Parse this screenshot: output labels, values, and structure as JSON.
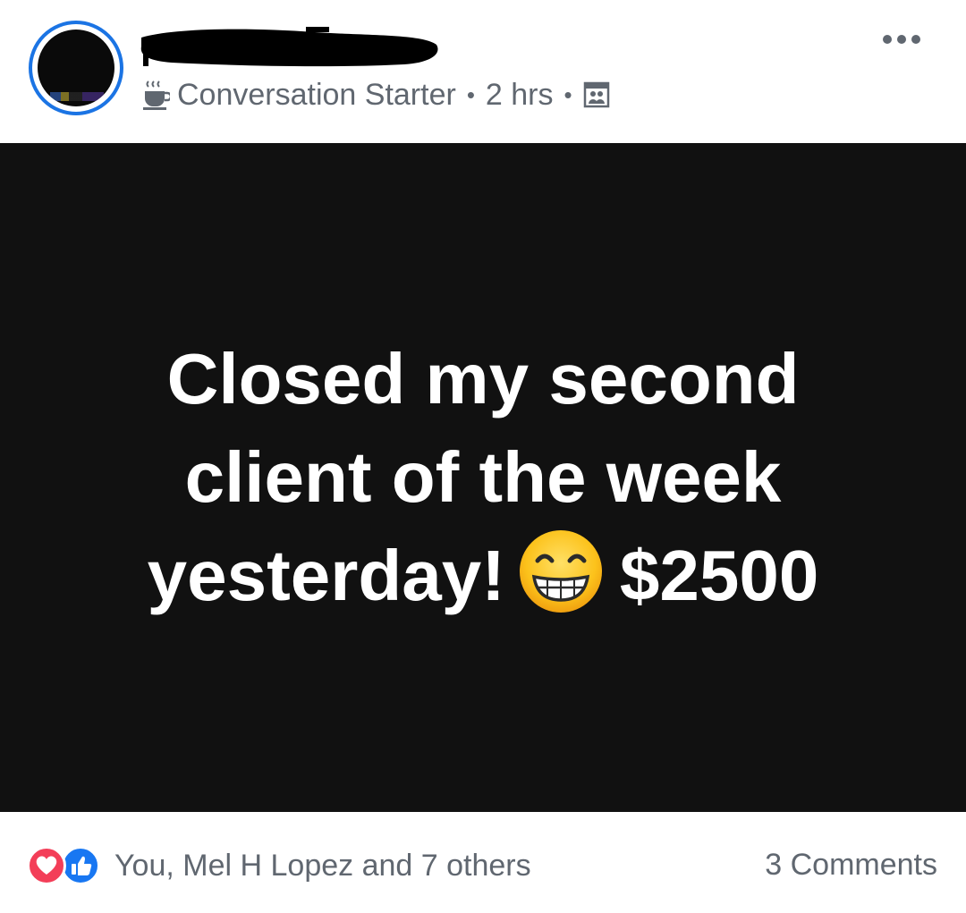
{
  "header": {
    "author_name": "",
    "badge_label": "Conversation Starter",
    "badge_icon": "coffee-cup-icon",
    "separator": "•",
    "time": "2 hrs",
    "privacy_icon": "group-members-icon",
    "more_icon": "more-options-icon",
    "accent_color": "#1b74e4"
  },
  "post": {
    "background_color": "#111111",
    "text_color": "#ffffff",
    "line1": "Closed my second",
    "line2": "client of the week",
    "line3_before_emoji": "yesterday!",
    "emoji": "grinning-face-with-smiling-eyes-icon",
    "line3_after_emoji": "$2500"
  },
  "footer": {
    "reaction_icons": [
      "love-reaction-icon",
      "like-reaction-icon"
    ],
    "reactors": "You, Mel H Lopez and 7 others",
    "comments": "3 Comments",
    "love_color": "#f33e58",
    "like_color": "#1877f2"
  }
}
